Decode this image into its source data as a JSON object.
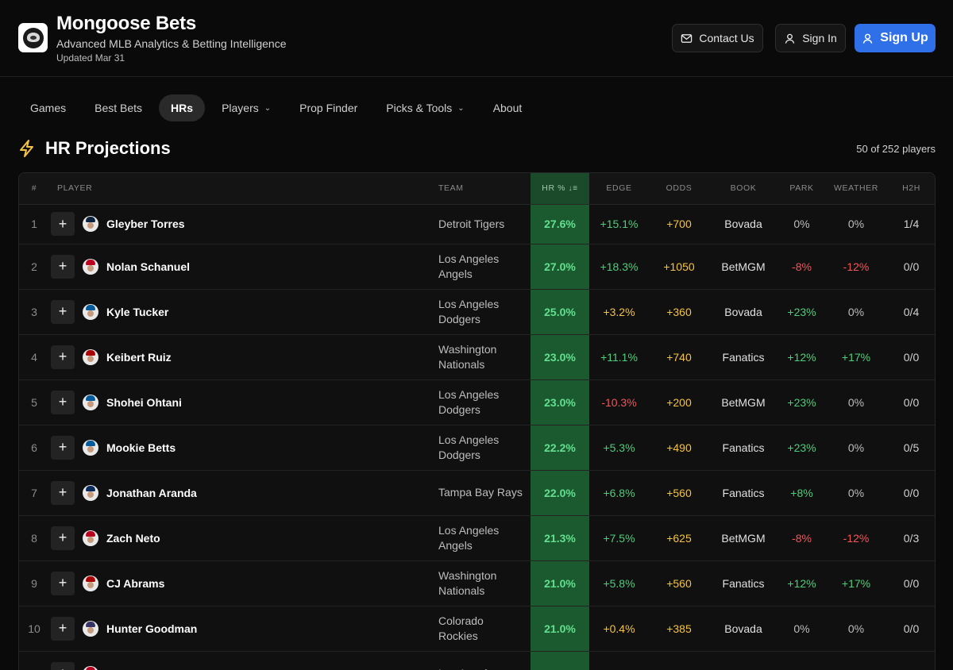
{
  "header": {
    "title": "Mongoose Bets",
    "subtitle": "Advanced MLB Analytics & Betting Intelligence",
    "updated": "Updated Mar 31",
    "contact_label": "Contact Us",
    "signin_label": "Sign In",
    "signup_label": "Sign Up"
  },
  "nav": {
    "items": [
      "Games",
      "Best Bets",
      "HRs",
      "Players",
      "Prop Finder",
      "Picks & Tools",
      "About"
    ],
    "active": "HRs"
  },
  "section": {
    "title": "HR Projections",
    "count": "50 of 252 players"
  },
  "table": {
    "columns": [
      "#",
      "PLAYER",
      "TEAM",
      "HR %",
      "EDGE",
      "ODDS",
      "BOOK",
      "PARK",
      "WEATHER",
      "H2H"
    ],
    "sort_column": "HR %",
    "rows": [
      {
        "rank": "1",
        "player": "Gleyber Torres",
        "team": "Detroit Tigers",
        "hr": "27.6%",
        "edge": "+15.1%",
        "odds": "+700",
        "book": "Bovada",
        "park": "0%",
        "weather": "0%",
        "h2h": "1/4"
      },
      {
        "rank": "2",
        "player": "Nolan Schanuel",
        "team": "Los Angeles Angels",
        "hr": "27.0%",
        "edge": "+18.3%",
        "odds": "+1050",
        "book": "BetMGM",
        "park": "-8%",
        "weather": "-12%",
        "h2h": "0/0"
      },
      {
        "rank": "3",
        "player": "Kyle Tucker",
        "team": "Los Angeles Dodgers",
        "hr": "25.0%",
        "edge": "+3.2%",
        "odds": "+360",
        "book": "Bovada",
        "park": "+23%",
        "weather": "0%",
        "h2h": "0/4"
      },
      {
        "rank": "4",
        "player": "Keibert Ruiz",
        "team": "Washington Nationals",
        "hr": "23.0%",
        "edge": "+11.1%",
        "odds": "+740",
        "book": "Fanatics",
        "park": "+12%",
        "weather": "+17%",
        "h2h": "0/0"
      },
      {
        "rank": "5",
        "player": "Shohei Ohtani",
        "team": "Los Angeles Dodgers",
        "hr": "23.0%",
        "edge": "-10.3%",
        "odds": "+200",
        "book": "BetMGM",
        "park": "+23%",
        "weather": "0%",
        "h2h": "0/0"
      },
      {
        "rank": "6",
        "player": "Mookie Betts",
        "team": "Los Angeles Dodgers",
        "hr": "22.2%",
        "edge": "+5.3%",
        "odds": "+490",
        "book": "Fanatics",
        "park": "+23%",
        "weather": "0%",
        "h2h": "0/5"
      },
      {
        "rank": "7",
        "player": "Jonathan Aranda",
        "team": "Tampa Bay Rays",
        "hr": "22.0%",
        "edge": "+6.8%",
        "odds": "+560",
        "book": "Fanatics",
        "park": "+8%",
        "weather": "0%",
        "h2h": "0/0"
      },
      {
        "rank": "8",
        "player": "Zach Neto",
        "team": "Los Angeles Angels",
        "hr": "21.3%",
        "edge": "+7.5%",
        "odds": "+625",
        "book": "BetMGM",
        "park": "-8%",
        "weather": "-12%",
        "h2h": "0/3"
      },
      {
        "rank": "9",
        "player": "CJ Abrams",
        "team": "Washington Nationals",
        "hr": "21.0%",
        "edge": "+5.8%",
        "odds": "+560",
        "book": "Fanatics",
        "park": "+12%",
        "weather": "+17%",
        "h2h": "0/0"
      },
      {
        "rank": "10",
        "player": "Hunter Goodman",
        "team": "Colorado Rockies",
        "hr": "21.0%",
        "edge": "+0.4%",
        "odds": "+385",
        "book": "Bovada",
        "park": "0%",
        "weather": "0%",
        "h2h": "0/0"
      },
      {
        "rank": "",
        "player": "",
        "team": "Los Angeles",
        "hr": "",
        "edge": "",
        "odds": "",
        "book": "",
        "park": "",
        "weather": "",
        "h2h": ""
      }
    ]
  },
  "colors": {
    "accent": "#2f6fe8",
    "hr_cell": "#1b5a2f",
    "positive": "#4ccf7a",
    "negative": "#f0565a",
    "odds": "#f5c343",
    "bolt": "#f5c343"
  }
}
